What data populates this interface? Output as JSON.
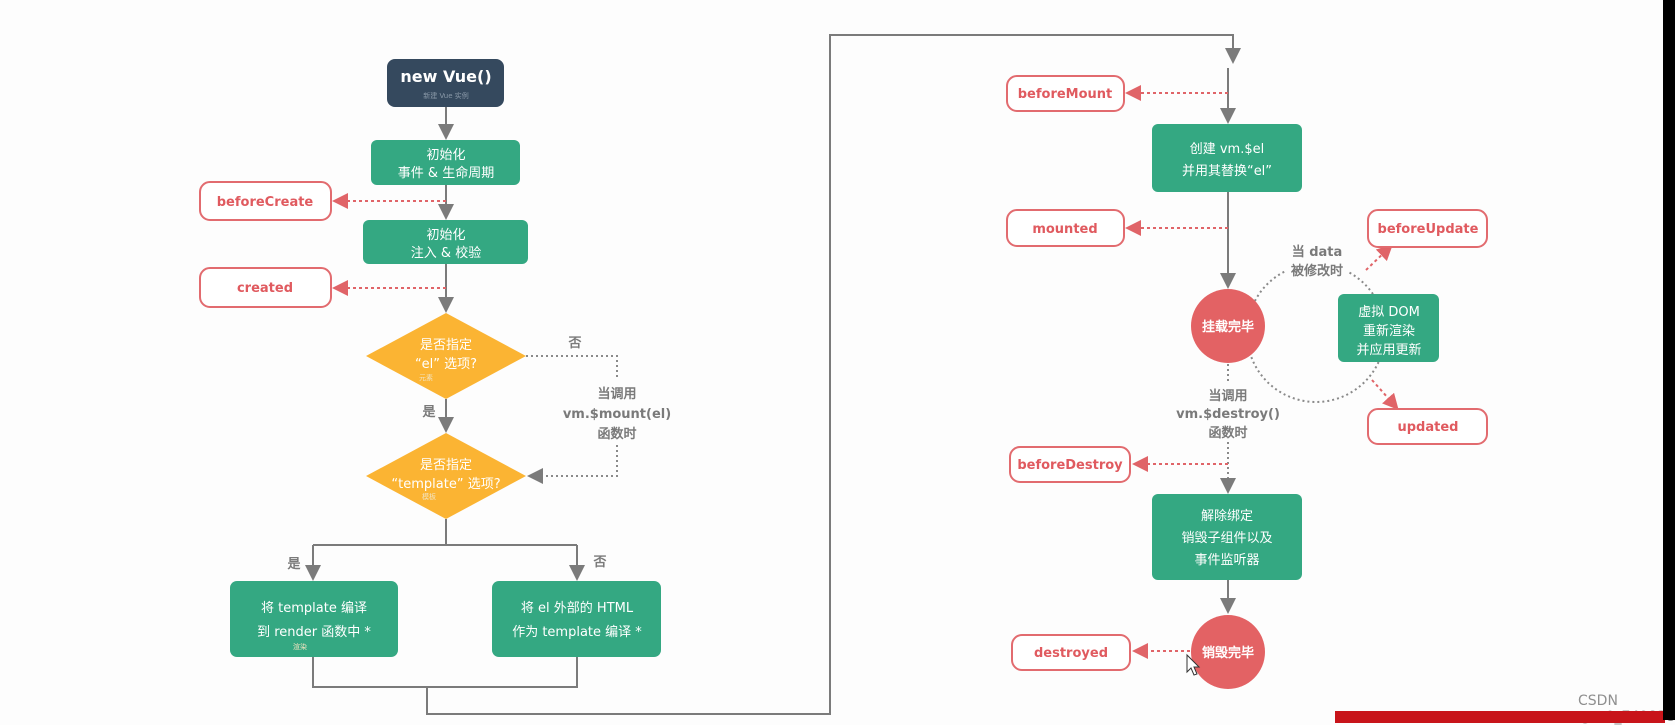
{
  "colors": {
    "green": "#34a882",
    "navy": "#35495e",
    "orange": "#fbb433",
    "hook_red": "#e05a5f",
    "circle_red": "#e36264"
  },
  "flow": {
    "new_vue": {
      "title": "new Vue()",
      "subtitle": "新建 Vue 实例"
    },
    "init_events": {
      "line1": "初始化",
      "line2": "事件 & 生命周期"
    },
    "init_inject": {
      "line1": "初始化",
      "line2": "注入 & 校验"
    },
    "el_question": {
      "line1": "是否指定",
      "line2": "“el” 选项?",
      "note": "元素"
    },
    "template_question": {
      "line1": "是否指定",
      "line2": "“template” 选项?",
      "note": "模板"
    },
    "yes": "是",
    "no": "否",
    "mount_call": {
      "line1": "当调用",
      "line2": "vm.$mount(el)",
      "line3": "函数时"
    },
    "compile_template": {
      "line1": "将 template 编译",
      "line2": "到 render 函数中 *",
      "note": "渲染"
    },
    "compile_outer_html": {
      "line1": "将 el 外部的 HTML",
      "line2": "作为 template 编译 *"
    },
    "create_el": {
      "line1": "创建 vm.$el",
      "line2": "并用其替换“el”"
    },
    "mounted_state": "挂载完毕",
    "data_changed": {
      "line1": "当 data",
      "line2": "被修改时"
    },
    "virtual_dom": {
      "line1": "虚拟 DOM",
      "line2": "重新渲染",
      "line3": "并应用更新"
    },
    "destroy_call": {
      "line1": "当调用",
      "line2": "vm.$destroy()",
      "line3": "函数时"
    },
    "teardown": {
      "line1": "解除绑定",
      "line2": "销毁子组件以及",
      "line3": "事件监听器"
    },
    "destroyed_state": "销毁完毕"
  },
  "hooks": {
    "beforeCreate": "beforeCreate",
    "created": "created",
    "beforeMount": "beforeMount",
    "mounted": "mounted",
    "beforeUpdate": "beforeUpdate",
    "updated": "updated",
    "beforeDestroy": "beforeDestroy",
    "destroyed": "destroyed"
  },
  "watermark": "CSDN @m0_74983863"
}
